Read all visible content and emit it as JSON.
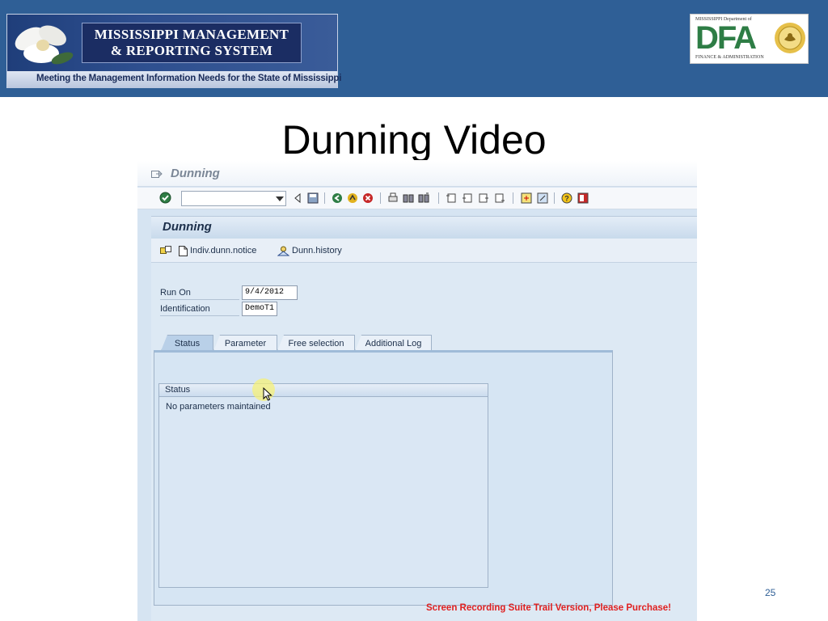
{
  "header": {
    "banner_line1": "MISSISSIPPI MANAGEMENT",
    "banner_line2": "& REPORTING SYSTEM",
    "banner_tagline": "Meeting the Management Information Needs for the State of Mississippi",
    "dfa_top": "MISSISSIPPI Department of",
    "dfa_letters": "DFA",
    "dfa_bottom": "FINANCE & ADMINISTRATION"
  },
  "slide": {
    "title": "Dunning Video",
    "page_number": "25",
    "watermark": "Screen Recording Suite Trail Version, Please Purchase!"
  },
  "sap": {
    "window_title": "Dunning",
    "command_field_value": "",
    "screen_title": "Dunning",
    "app_toolbar": {
      "indiv_label": "Indiv.dunn.notice",
      "history_label": "Dunn.history"
    },
    "fields": {
      "run_on_label": "Run On",
      "run_on_value": "9/4/2012",
      "identification_label": "Identification",
      "identification_value": "DemoT1"
    },
    "tabs": [
      {
        "label": "Status",
        "active": true
      },
      {
        "label": "Parameter",
        "active": false
      },
      {
        "label": "Free selection",
        "active": false
      },
      {
        "label": "Additional Log",
        "active": false
      }
    ],
    "status_panel": {
      "title": "Status",
      "message": "No parameters maintained"
    }
  },
  "colors": {
    "header_band": "#2f5f96",
    "sap_background": "#d6e4f2",
    "watermark": "#e02020",
    "dfa_green": "#2e7d45"
  }
}
